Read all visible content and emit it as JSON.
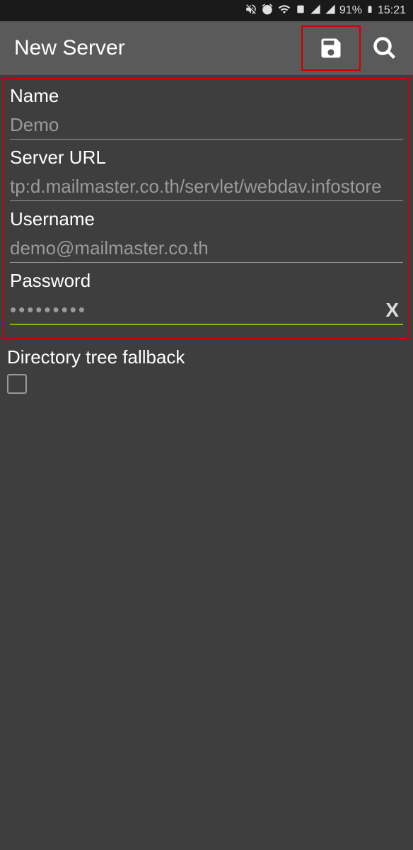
{
  "status": {
    "battery_pct": "91%",
    "time": "15:21"
  },
  "appbar": {
    "title": "New Server"
  },
  "form": {
    "name_label": "Name",
    "name_value": "Demo",
    "url_label": "Server URL",
    "url_value": "tp:d.mailmaster.co.th/servlet/webdav.infostore",
    "username_label": "Username",
    "username_value": "demo@mailmaster.co.th",
    "password_label": "Password",
    "password_value": "•••••••••"
  },
  "fallback": {
    "label": "Directory tree fallback"
  }
}
